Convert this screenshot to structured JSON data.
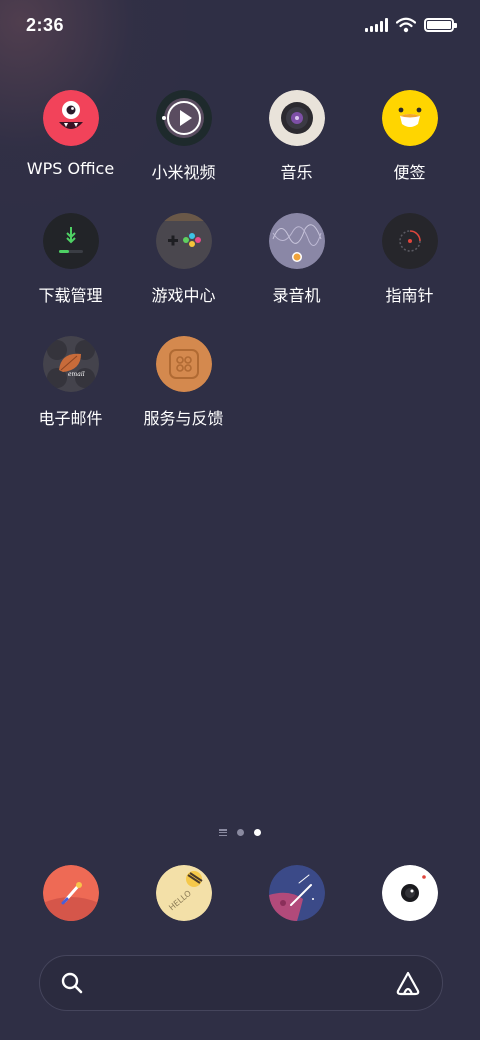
{
  "status_bar": {
    "time": "2:36",
    "signal_icon": "cellular-signal-icon",
    "wifi_icon": "wifi-icon",
    "battery_icon": "battery-icon",
    "battery_level": 1.0
  },
  "apps": [
    {
      "label": "WPS Office",
      "icon": "wps-office-icon"
    },
    {
      "label": "小米视频",
      "icon": "video-play-icon"
    },
    {
      "label": "音乐",
      "icon": "music-disc-icon"
    },
    {
      "label": "便签",
      "icon": "notes-chick-icon"
    },
    {
      "label": "下载管理",
      "icon": "download-icon"
    },
    {
      "label": "游戏中心",
      "icon": "gamepad-icon"
    },
    {
      "label": "录音机",
      "icon": "recorder-icon"
    },
    {
      "label": "指南针",
      "icon": "compass-icon"
    },
    {
      "label": "电子邮件",
      "icon": "email-icon"
    },
    {
      "label": "服务与反馈",
      "icon": "service-feedback-icon"
    }
  ],
  "page_indicator": {
    "pages": 2,
    "active_page": 2
  },
  "dock": [
    {
      "icon": "browser-rocket-icon"
    },
    {
      "icon": "messages-hello-icon"
    },
    {
      "icon": "gallery-meteor-icon"
    },
    {
      "icon": "camera-icon"
    }
  ],
  "search_bar": {
    "search_icon": "search-icon",
    "assistant_icon": "assistant-icon"
  },
  "colors": {
    "background": "#2f2f45",
    "wps_red": "#f2435a",
    "notes_yellow": "#ffd500",
    "service_orange": "#d4894e",
    "browser_coral": "#ee6a55"
  }
}
